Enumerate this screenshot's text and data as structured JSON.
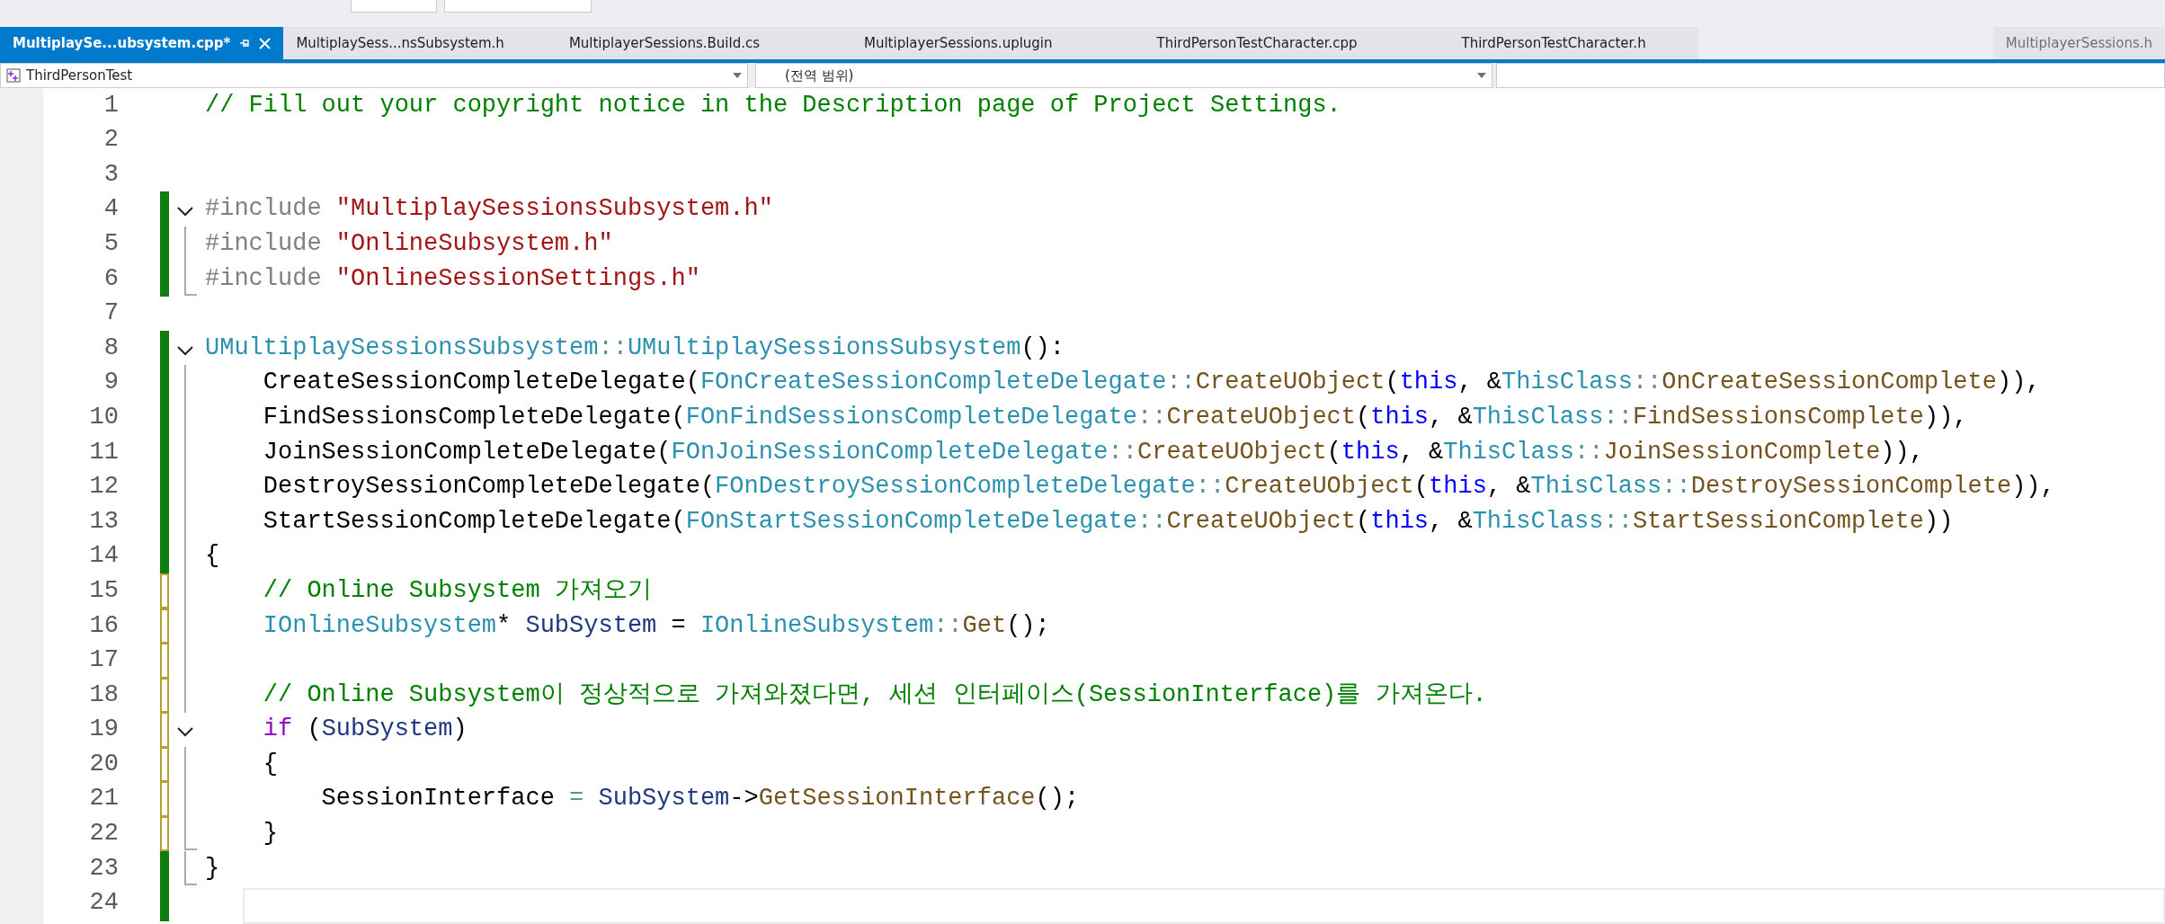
{
  "tabs": [
    {
      "label": "MultiplaySe...ubsystem.cpp*",
      "selected": true,
      "kind": "document"
    },
    {
      "label": "MultiplaySess...nsSubsystem.h",
      "selected": false,
      "kind": "document"
    },
    {
      "label": "MultiplayerSessions.Build.cs",
      "selected": false,
      "kind": "document"
    },
    {
      "label": "MultiplayerSessions.uplugin",
      "selected": false,
      "kind": "document"
    },
    {
      "label": "ThirdPersonTestCharacter.cpp",
      "selected": false,
      "kind": "document"
    },
    {
      "label": "ThirdPersonTestCharacter.h",
      "selected": false,
      "kind": "document"
    },
    {
      "label": "MultiplayerSessions.h",
      "selected": false,
      "kind": "preview"
    }
  ],
  "navigation": {
    "project": "ThirdPersonTest",
    "scope": "(전역 범위)"
  },
  "lines": [
    {
      "number": "1",
      "tokens": [
        {
          "t": "// Fill out your copyright notice in the Description page of Project Settings.",
          "kind": "comment"
        }
      ]
    },
    {
      "number": "2"
    },
    {
      "number": "3"
    },
    {
      "number": "4",
      "change_bar": {
        "kind": "saved"
      },
      "fold_marker": {
        "kind": "collapse"
      },
      "tokens": [
        {
          "t": "#include ",
          "kind": "preproc"
        },
        {
          "t": "\"MultiplaySessionsSubsystem.h\"",
          "kind": "string"
        }
      ]
    },
    {
      "number": "5",
      "change_bar": {
        "kind": "saved"
      },
      "fold_marker": {
        "kind": "guide"
      },
      "tokens": [
        {
          "t": "#include ",
          "kind": "preproc"
        },
        {
          "t": "\"OnlineSubsystem.h\"",
          "kind": "string"
        }
      ]
    },
    {
      "number": "6",
      "change_bar": {
        "kind": "saved"
      },
      "fold_marker": {
        "kind": "end"
      },
      "tokens": [
        {
          "t": "#include ",
          "kind": "preproc"
        },
        {
          "t": "\"OnlineSessionSettings.h\"",
          "kind": "string"
        }
      ]
    },
    {
      "number": "7"
    },
    {
      "number": "8",
      "change_bar": {
        "kind": "saved"
      },
      "fold_marker": {
        "kind": "collapse"
      },
      "tokens": [
        {
          "t": "UMultiplaySessionsSubsystem",
          "kind": "type"
        },
        {
          "t": "::",
          "kind": "op"
        },
        {
          "t": "UMultiplaySessionsSubsystem",
          "kind": "type"
        },
        {
          "t": "():",
          "kind": "plain"
        }
      ]
    },
    {
      "number": "9",
      "change_bar": {
        "kind": "saved"
      },
      "fold_marker": {
        "kind": "guide"
      },
      "tokens": [
        {
          "t": "    CreateSessionCompleteDelegate(",
          "kind": "plain"
        },
        {
          "t": "FOnCreateSessionCompleteDelegate",
          "kind": "type"
        },
        {
          "t": "::",
          "kind": "op"
        },
        {
          "t": "CreateUObject",
          "kind": "func"
        },
        {
          "t": "(",
          "kind": "plain"
        },
        {
          "t": "this",
          "kind": "keyword"
        },
        {
          "t": ", &",
          "kind": "plain"
        },
        {
          "t": "ThisClass",
          "kind": "type"
        },
        {
          "t": "::",
          "kind": "op"
        },
        {
          "t": "OnCreateSessionComplete",
          "kind": "func"
        },
        {
          "t": ")),",
          "kind": "plain"
        }
      ]
    },
    {
      "number": "10",
      "change_bar": {
        "kind": "saved"
      },
      "fold_marker": {
        "kind": "guide"
      },
      "tokens": [
        {
          "t": "    FindSessionsCompleteDelegate(",
          "kind": "plain"
        },
        {
          "t": "FOnFindSessionsCompleteDelegate",
          "kind": "type"
        },
        {
          "t": "::",
          "kind": "op"
        },
        {
          "t": "CreateUObject",
          "kind": "func"
        },
        {
          "t": "(",
          "kind": "plain"
        },
        {
          "t": "this",
          "kind": "keyword"
        },
        {
          "t": ", &",
          "kind": "plain"
        },
        {
          "t": "ThisClass",
          "kind": "type"
        },
        {
          "t": "::",
          "kind": "op"
        },
        {
          "t": "FindSessionsComplete",
          "kind": "func"
        },
        {
          "t": ")),",
          "kind": "plain"
        }
      ]
    },
    {
      "number": "11",
      "change_bar": {
        "kind": "saved"
      },
      "fold_marker": {
        "kind": "guide"
      },
      "tokens": [
        {
          "t": "    JoinSessionCompleteDelegate(",
          "kind": "plain"
        },
        {
          "t": "FOnJoinSessionCompleteDelegate",
          "kind": "type"
        },
        {
          "t": "::",
          "kind": "op"
        },
        {
          "t": "CreateUObject",
          "kind": "func"
        },
        {
          "t": "(",
          "kind": "plain"
        },
        {
          "t": "this",
          "kind": "keyword"
        },
        {
          "t": ", &",
          "kind": "plain"
        },
        {
          "t": "ThisClass",
          "kind": "type"
        },
        {
          "t": "::",
          "kind": "op"
        },
        {
          "t": "JoinSessionComplete",
          "kind": "func"
        },
        {
          "t": ")),",
          "kind": "plain"
        }
      ]
    },
    {
      "number": "12",
      "change_bar": {
        "kind": "saved"
      },
      "fold_marker": {
        "kind": "guide"
      },
      "tokens": [
        {
          "t": "    DestroySessionCompleteDelegate(",
          "kind": "plain"
        },
        {
          "t": "FOnDestroySessionCompleteDelegate",
          "kind": "type"
        },
        {
          "t": "::",
          "kind": "op"
        },
        {
          "t": "CreateUObject",
          "kind": "func"
        },
        {
          "t": "(",
          "kind": "plain"
        },
        {
          "t": "this",
          "kind": "keyword"
        },
        {
          "t": ", &",
          "kind": "plain"
        },
        {
          "t": "ThisClass",
          "kind": "type"
        },
        {
          "t": "::",
          "kind": "op"
        },
        {
          "t": "DestroySessionComplete",
          "kind": "func"
        },
        {
          "t": ")),",
          "kind": "plain"
        }
      ]
    },
    {
      "number": "13",
      "change_bar": {
        "kind": "saved"
      },
      "fold_marker": {
        "kind": "guide"
      },
      "tokens": [
        {
          "t": "    StartSessionCompleteDelegate(",
          "kind": "plain"
        },
        {
          "t": "FOnStartSessionCompleteDelegate",
          "kind": "type"
        },
        {
          "t": "::",
          "kind": "op"
        },
        {
          "t": "CreateUObject",
          "kind": "func"
        },
        {
          "t": "(",
          "kind": "plain"
        },
        {
          "t": "this",
          "kind": "keyword"
        },
        {
          "t": ", &",
          "kind": "plain"
        },
        {
          "t": "ThisClass",
          "kind": "type"
        },
        {
          "t": "::",
          "kind": "op"
        },
        {
          "t": "StartSessionComplete",
          "kind": "func"
        },
        {
          "t": "))",
          "kind": "plain"
        }
      ]
    },
    {
      "number": "14",
      "change_bar": {
        "kind": "saved"
      },
      "fold_marker": {
        "kind": "guide"
      },
      "tokens": [
        {
          "t": "{",
          "kind": "plain"
        }
      ]
    },
    {
      "number": "15",
      "change_bar": {
        "kind": "unsaved"
      },
      "fold_marker": {
        "kind": "guide"
      },
      "tokens": [
        {
          "t": "    // Online Subsystem 가져오기",
          "kind": "comment"
        }
      ]
    },
    {
      "number": "16",
      "change_bar": {
        "kind": "unsaved"
      },
      "fold_marker": {
        "kind": "guide"
      },
      "tokens": [
        {
          "t": "    IOnlineSubsystem",
          "kind": "type"
        },
        {
          "t": "* ",
          "kind": "plain"
        },
        {
          "t": "SubSystem",
          "kind": "local"
        },
        {
          "t": " = ",
          "kind": "plain"
        },
        {
          "t": "IOnlineSubsystem",
          "kind": "type"
        },
        {
          "t": "::",
          "kind": "op"
        },
        {
          "t": "Get",
          "kind": "func"
        },
        {
          "t": "();",
          "kind": "plain"
        }
      ]
    },
    {
      "number": "17",
      "change_bar": {
        "kind": "unsaved"
      },
      "fold_marker": {
        "kind": "guide"
      }
    },
    {
      "number": "18",
      "change_bar": {
        "kind": "unsaved"
      },
      "fold_marker": {
        "kind": "guide"
      },
      "tokens": [
        {
          "t": "    // Online Subsystem이 정상적으로 가져와졌다면, 세션 인터페이스(SessionInterface)를 가져온다.",
          "kind": "comment"
        }
      ]
    },
    {
      "number": "19",
      "change_bar": {
        "kind": "unsaved"
      },
      "fold_marker": {
        "kind": "collapse"
      },
      "tokens": [
        {
          "t": "    if",
          "kind": "control"
        },
        {
          "t": " (",
          "kind": "plain"
        },
        {
          "t": "SubSystem",
          "kind": "local"
        },
        {
          "t": ")",
          "kind": "plain"
        }
      ]
    },
    {
      "number": "20",
      "change_bar": {
        "kind": "unsaved"
      },
      "fold_marker": {
        "kind": "guide"
      },
      "tokens": [
        {
          "t": "    {",
          "kind": "plain"
        }
      ]
    },
    {
      "number": "21",
      "change_bar": {
        "kind": "unsaved"
      },
      "fold_marker": {
        "kind": "guide"
      },
      "tokens": [
        {
          "t": "        SessionInterface ",
          "kind": "plain"
        },
        {
          "t": "=",
          "kind": "op"
        },
        {
          "t": " SubSystem",
          "kind": "local"
        },
        {
          "t": "->",
          "kind": "plain"
        },
        {
          "t": "GetSessionInterface",
          "kind": "func"
        },
        {
          "t": "();",
          "kind": "plain"
        }
      ]
    },
    {
      "number": "22",
      "change_bar": {
        "kind": "unsaved"
      },
      "fold_marker": {
        "kind": "end"
      },
      "tokens": [
        {
          "t": "    }",
          "kind": "plain"
        }
      ]
    },
    {
      "number": "23",
      "change_bar": {
        "kind": "saved"
      },
      "fold_marker": {
        "kind": "end"
      },
      "tokens": [
        {
          "t": "}",
          "kind": "plain"
        }
      ]
    },
    {
      "number": "24",
      "change_bar": {
        "kind": "saved"
      },
      "current": true
    }
  ]
}
